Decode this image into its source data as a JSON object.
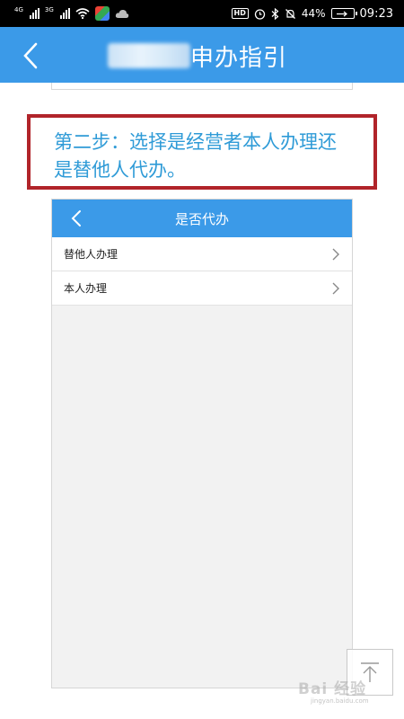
{
  "status_bar": {
    "sim1_label": "4G",
    "sim2_label": "3G",
    "hd_label": "HD",
    "battery_percent": "44%",
    "time": "09:23"
  },
  "header": {
    "title": "申办指引"
  },
  "step": {
    "text": "第二步：选择是经营者本人办理还是替他人代办。"
  },
  "inner_screen": {
    "title": "是否代办",
    "options": [
      {
        "label": "替他人办理"
      },
      {
        "label": "本人办理"
      }
    ]
  },
  "watermark": {
    "main": "Bai 经验",
    "sub": "jingyan.baidu.com"
  },
  "colors": {
    "header_blue": "#3b9ae8",
    "step_text": "#2f9bd7",
    "step_border": "#b1242a"
  }
}
